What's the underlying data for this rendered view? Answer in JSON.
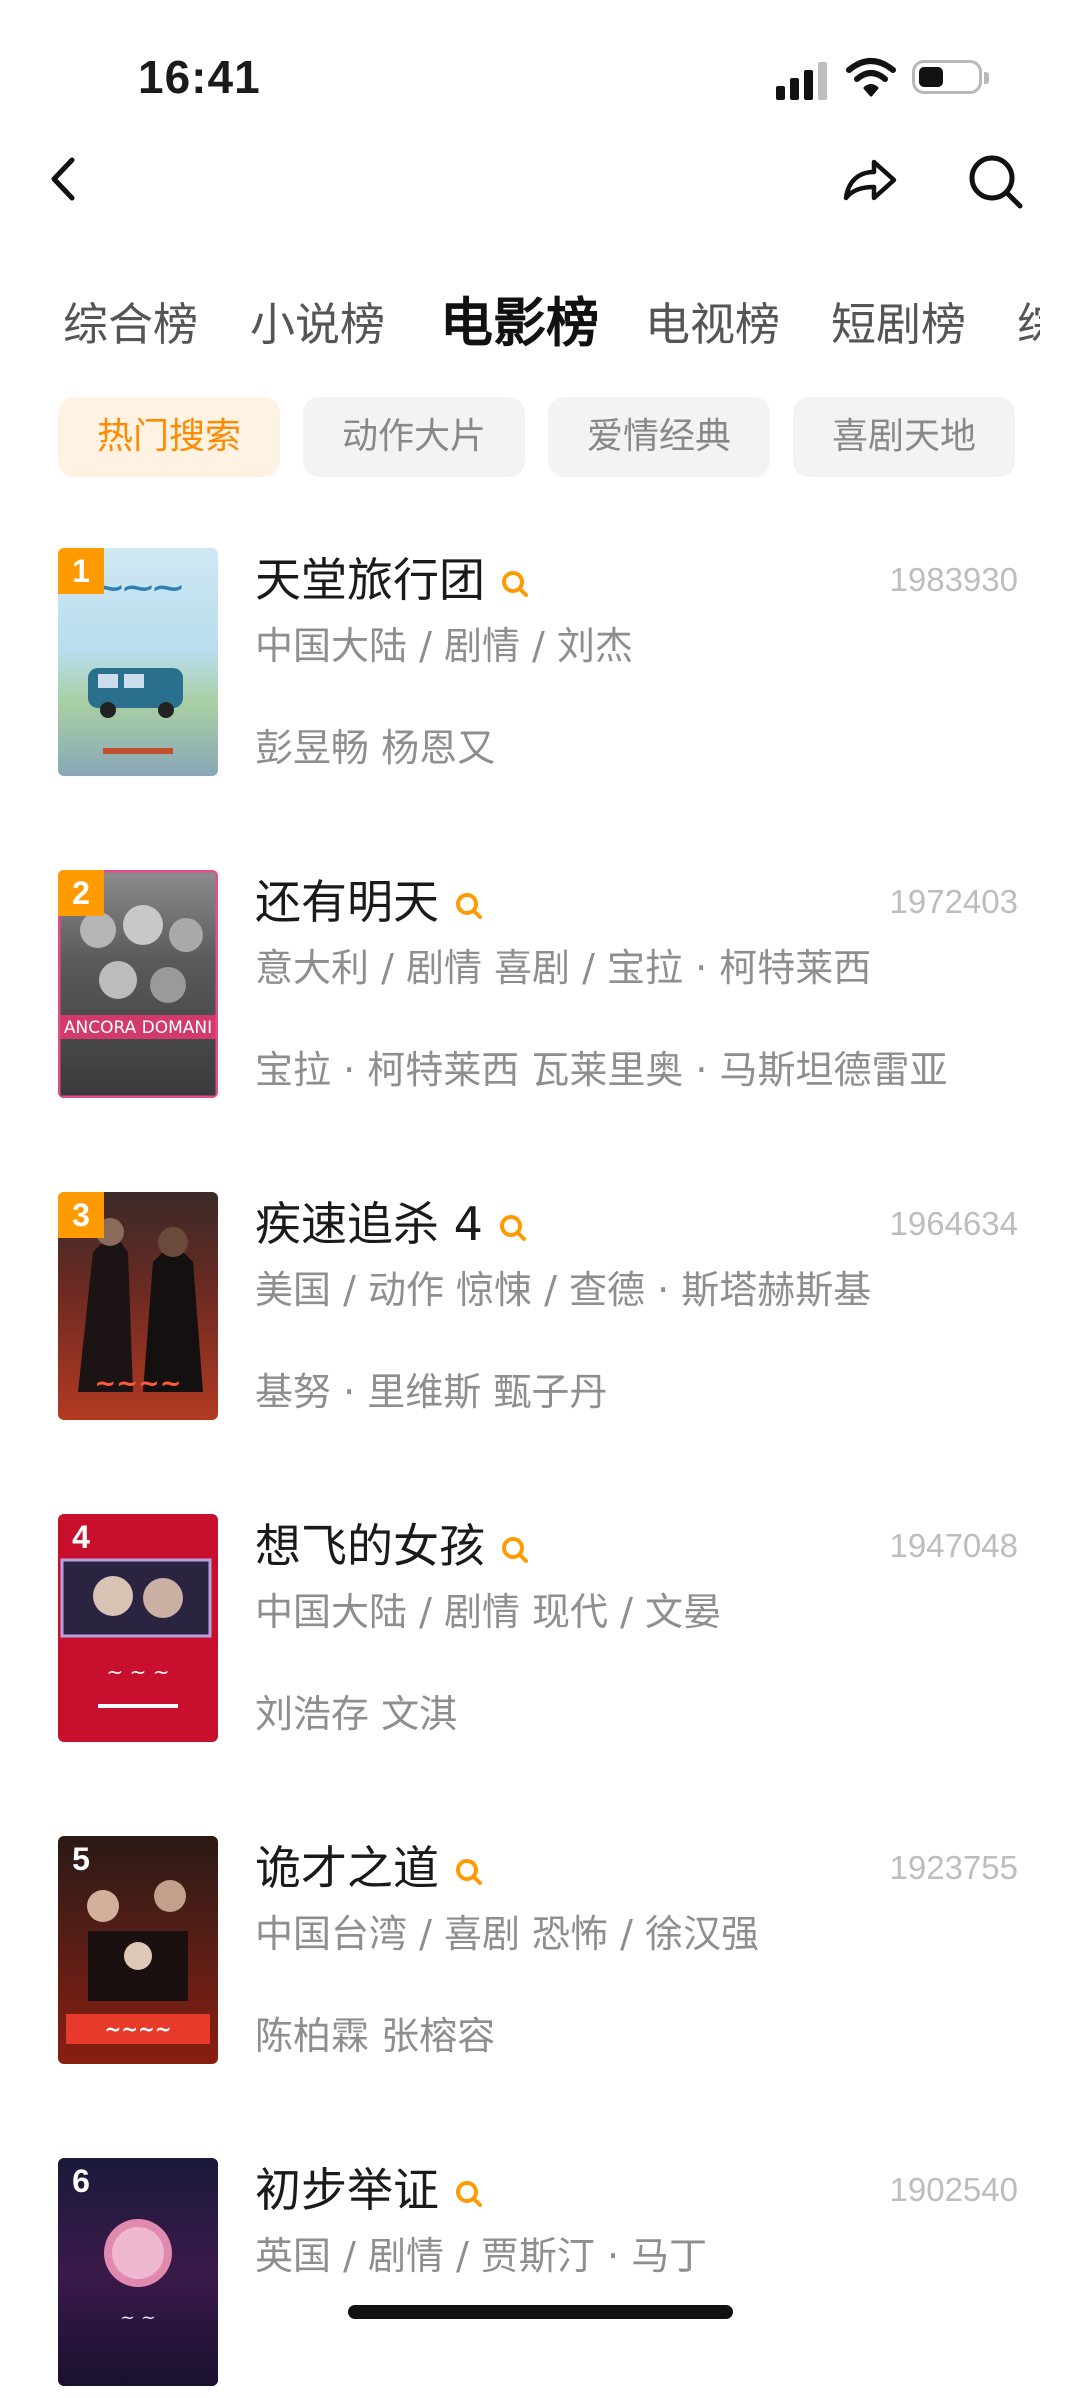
{
  "status_bar": {
    "time": "16:41"
  },
  "tabs": [
    {
      "label": "综合榜",
      "active": false
    },
    {
      "label": "小说榜",
      "active": false
    },
    {
      "label": "电影榜",
      "active": true
    },
    {
      "label": "电视榜",
      "active": false
    },
    {
      "label": "短剧榜",
      "active": false
    },
    {
      "label": "综",
      "active": false
    }
  ],
  "chips": [
    {
      "label": "热门搜索",
      "active": true
    },
    {
      "label": "动作大片",
      "active": false
    },
    {
      "label": "爱情经典",
      "active": false
    },
    {
      "label": "喜剧天地",
      "active": false
    }
  ],
  "accent_color": "#ff8a00",
  "items": [
    {
      "rank": "1",
      "title": "天堂旅行团",
      "count": "1983930",
      "meta": "中国大陆 / 剧情 / 刘杰",
      "cast": "彭昱畅 杨恩又"
    },
    {
      "rank": "2",
      "title": "还有明天",
      "count": "1972403",
      "meta": "意大利 / 剧情 喜剧 / 宝拉 · 柯特莱西",
      "cast": "宝拉 · 柯特莱西 瓦莱里奥 · 马斯坦德雷亚"
    },
    {
      "rank": "3",
      "title": "疾速追杀 4",
      "count": "1964634",
      "meta": "美国 / 动作 惊悚 / 查德 · 斯塔赫斯基",
      "cast": "基努 · 里维斯 甄子丹"
    },
    {
      "rank": "4",
      "title": "想飞的女孩",
      "count": "1947048",
      "meta": "中国大陆 / 剧情 现代 / 文晏",
      "cast": "刘浩存 文淇"
    },
    {
      "rank": "5",
      "title": "诡才之道",
      "count": "1923755",
      "meta": "中国台湾 / 喜剧 恐怖 / 徐汉强",
      "cast": "陈柏霖 张榕容"
    },
    {
      "rank": "6",
      "title": "初步举证",
      "count": "1902540",
      "meta": "英国 / 剧情 / 贾斯汀 · 马丁",
      "cast": ""
    }
  ]
}
